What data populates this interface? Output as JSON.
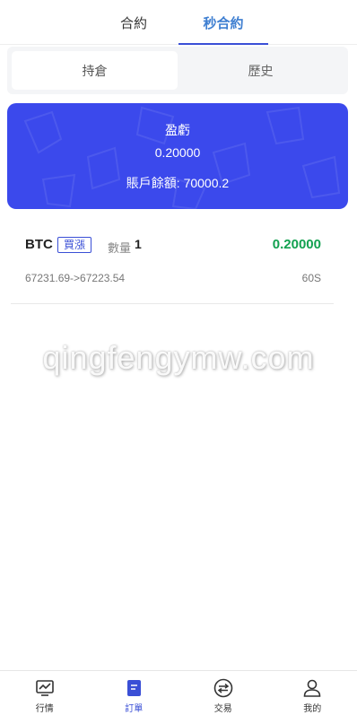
{
  "top_tabs": [
    {
      "label": "合約"
    },
    {
      "label": "秒合約"
    }
  ],
  "segments": [
    {
      "label": "持倉"
    },
    {
      "label": "歷史"
    }
  ],
  "pnl_card": {
    "title": "盈虧",
    "value": "0.20000",
    "balance_label": "賬戶餘額:",
    "balance_value": "70000.2",
    "color": "#3b49ec"
  },
  "order": {
    "symbol": "BTC",
    "direction": "買漲",
    "qty_label": "數量",
    "qty_value": "1",
    "pnl": "0.20000",
    "price_change": "67231.69->67223.54",
    "duration": "60S",
    "pnl_color": "#12a150"
  },
  "watermark": "qingfengymw.com",
  "bottom_nav": [
    {
      "label": "行情",
      "icon": "chart-monitor-icon"
    },
    {
      "label": "訂單",
      "icon": "order-book-icon"
    },
    {
      "label": "交易",
      "icon": "exchange-icon"
    },
    {
      "label": "我的",
      "icon": "user-icon"
    }
  ],
  "accent_color": "#3a4fd6"
}
